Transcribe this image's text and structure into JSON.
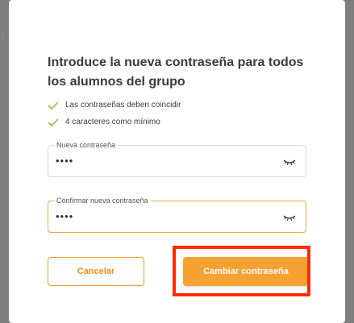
{
  "dialog": {
    "title": "Introduce la nueva contraseña para todos los alumnos del grupo",
    "rules": [
      {
        "text": "Las contraseñas deben coincidir",
        "icon": "check-icon"
      },
      {
        "text": "4 caracteres como mínimo",
        "icon": "check-icon"
      }
    ],
    "fields": {
      "new_password": {
        "label": "Nueva contraseña",
        "value": "••••",
        "icon": "eye-closed-icon"
      },
      "confirm_password": {
        "label": "Confirmar nueva contraseña",
        "value": "••••",
        "icon": "eye-closed-icon"
      }
    },
    "buttons": {
      "cancel": "Cancelar",
      "confirm": "Cambiar contraseña"
    }
  },
  "colors": {
    "accent": "#f5a233",
    "check": "#8cc63f",
    "highlight": "#ff2a00"
  }
}
